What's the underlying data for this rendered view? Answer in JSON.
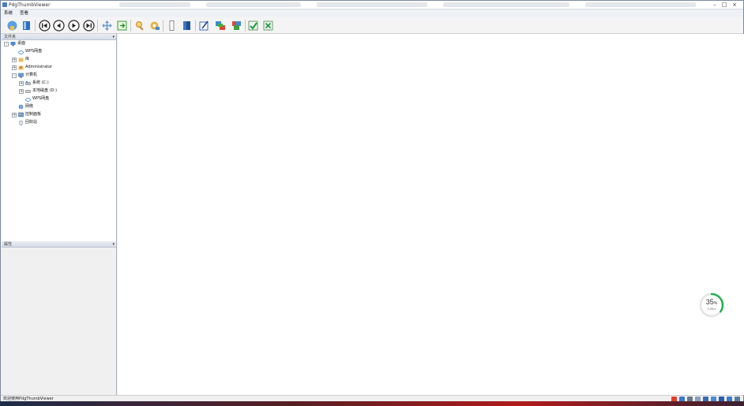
{
  "window": {
    "title": "PdgThumbViewer"
  },
  "menu": {
    "items": [
      "系统",
      "查看"
    ]
  },
  "toolbar": {
    "buttons": [
      "open-icon",
      "book-icon",
      "first-page-icon",
      "prev-page-icon",
      "next-page-icon",
      "last-page-icon",
      "move-icon",
      "export-icon",
      "search-icon",
      "settings-icon",
      "bookmark-icon",
      "book-stack-icon",
      "edit-icon",
      "convert-icon",
      "merge-icon",
      "check-icon",
      "close-icon"
    ]
  },
  "tree": {
    "header": "文件夹",
    "items": [
      {
        "label": "桌面",
        "icon": "desktop-icon",
        "expander": "-"
      },
      {
        "label": "WPS网盘",
        "icon": "cloud-icon",
        "expander": ""
      },
      {
        "label": "库",
        "icon": "library-icon",
        "expander": "+"
      },
      {
        "label": "Administrator",
        "icon": "user-icon",
        "expander": "+"
      },
      {
        "label": "计算机",
        "icon": "computer-icon",
        "expander": "-"
      },
      {
        "label": "系统 (C:)",
        "icon": "drive-icon",
        "expander": "+"
      },
      {
        "label": "本地磁盘 (D:)",
        "icon": "drive-icon",
        "expander": "+"
      },
      {
        "label": "WPS网盘",
        "icon": "cloud-icon",
        "expander": ""
      },
      {
        "label": "网络",
        "icon": "network-icon",
        "expander": ""
      },
      {
        "label": "控制面板",
        "icon": "control-panel-icon",
        "expander": "+"
      },
      {
        "label": "回收站",
        "icon": "recycle-bin-icon",
        "expander": ""
      }
    ]
  },
  "lower_pane": {
    "header": "属性"
  },
  "status": {
    "text": "欢迎使用PdgThumbViewer"
  },
  "gauge": {
    "percent": 35,
    "value": "35",
    "unit": "%",
    "sub": "0.5K/s"
  },
  "colors": {
    "gauge_ring": "#22b24c",
    "taskbar_accent": "#b01c1c"
  }
}
